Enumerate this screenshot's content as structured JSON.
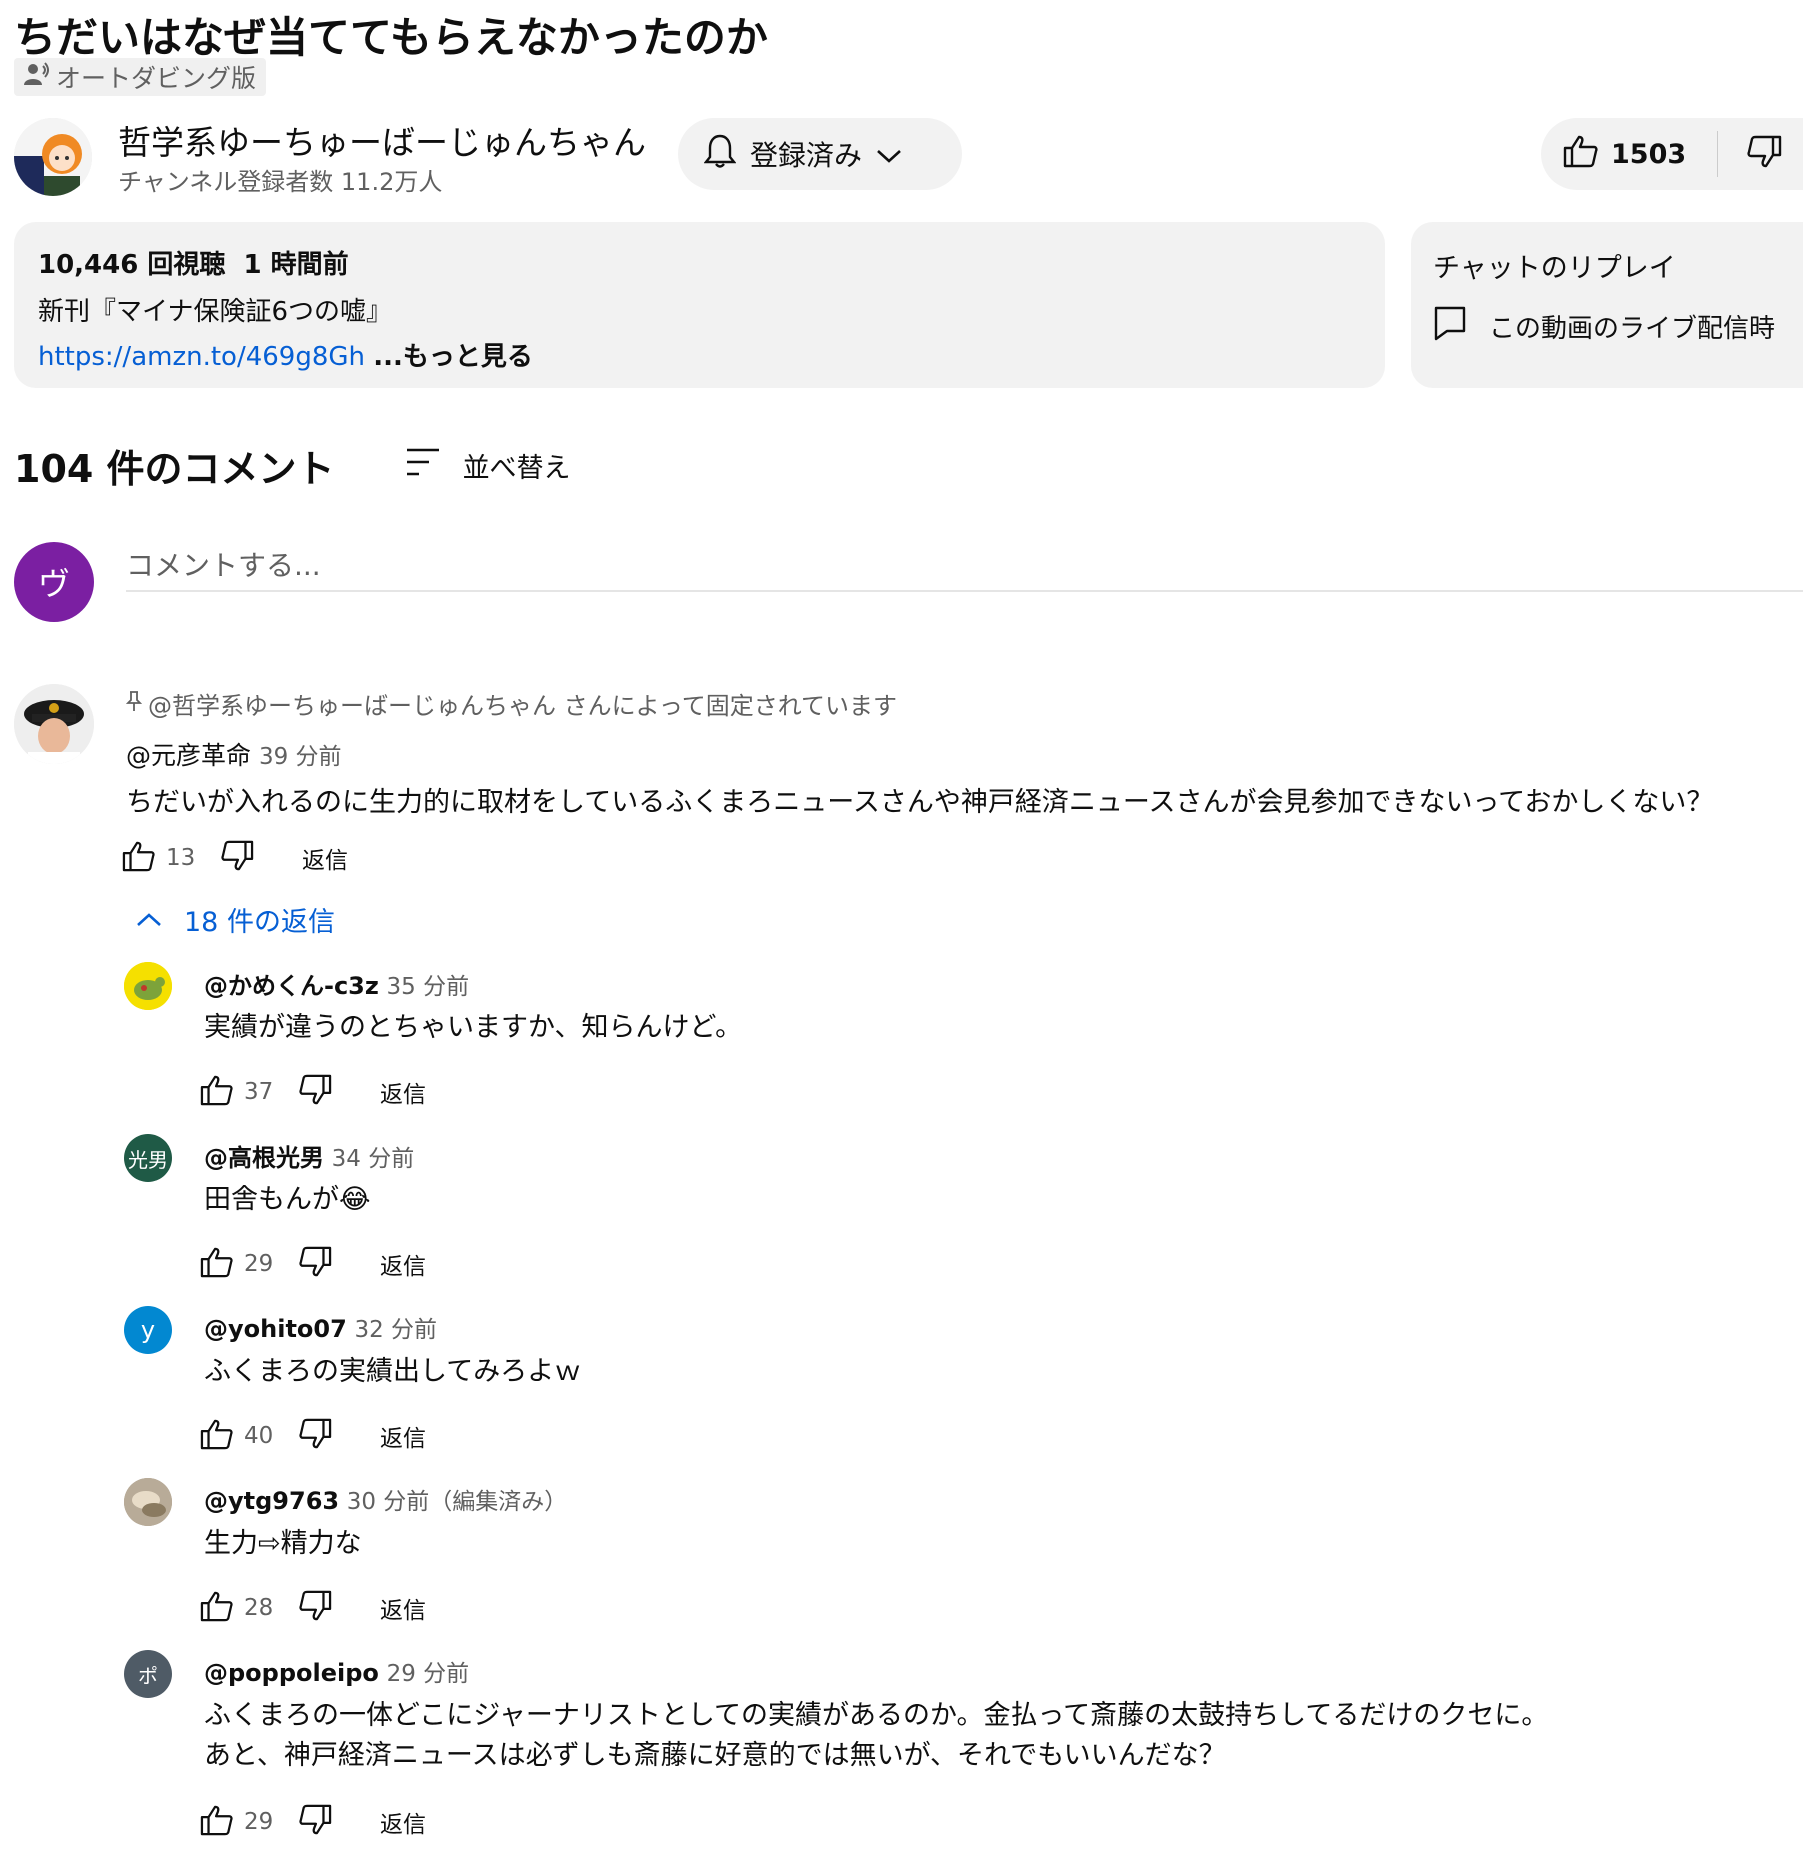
{
  "video": {
    "title": "ちだいはなぜ当ててもらえなかったのか",
    "dub_badge": "オートダビング版"
  },
  "channel": {
    "name": "哲学系ゆーちゅーばーじゅんちゃん",
    "subscribers": "チャンネル登録者数 11.2万人",
    "subscribe_label": "登録済み",
    "likes": "1503"
  },
  "description": {
    "views": "10,446 回視聴",
    "time": "1 時間前",
    "line2": "新刊『マイナ保険証6つの嘘』",
    "link": "https://amzn.to/469g8Gh",
    "more": "...もっと見る"
  },
  "chat": {
    "title": "チャットのリプレイ",
    "text": "この動画のライブ配信時"
  },
  "comments": {
    "count_label": "104 件のコメント",
    "sort_label": "並べ替え",
    "input_placeholder": "コメントする...",
    "my_avatar_letter": "ヴ",
    "top": {
      "pinned": "@哲学系ゆーちゅーばーじゅんちゃん さんによって固定されています",
      "author": "@元彦革命",
      "time": "39 分前",
      "text": "ちだいが入れるのに生力的に取材をしているふくまろニュースさんや神戸経済ニュースさんが会見参加できないっておかしくない？",
      "likes": "13",
      "reply": "返信",
      "replies_toggle": "18 件の返信"
    },
    "replies": [
      {
        "author": "@かめくん-c3z",
        "time": "35 分前",
        "text": "実績が違うのとちゃいますか、知らんけど。",
        "likes": "37",
        "reply": "返信",
        "avatar_text": "",
        "avatar_color": "#f5e000"
      },
      {
        "author": "@高根光男",
        "time": "34 分前",
        "text": "田舎もんが😂",
        "likes": "29",
        "reply": "返信",
        "avatar_text": "光男",
        "avatar_color": "#1f5a46"
      },
      {
        "author": "@yohito07",
        "time": "32 分前",
        "text": "ふくまろの実績出してみろよｗ",
        "likes": "40",
        "reply": "返信",
        "avatar_text": "y",
        "avatar_color": "#0288d1"
      },
      {
        "author": "@ytg9763",
        "time": "30 分前（編集済み）",
        "text": "生力⇨精力な",
        "likes": "28",
        "reply": "返信",
        "avatar_text": "",
        "avatar_color": "#a89b8a"
      },
      {
        "author": "@poppoleipo",
        "time": "29 分前",
        "text": "ふくまろの一体どこにジャーナリストとしての実績があるのか。金払って斎藤の太鼓持ちしてるだけのクセに。",
        "text2": "あと、神戸経済ニュースは必ずしも斎藤に好意的では無いが、それでもいいんだな？",
        "likes": "29",
        "reply": "返信",
        "avatar_text": "ポ",
        "avatar_color": "#4f5b66"
      }
    ]
  }
}
